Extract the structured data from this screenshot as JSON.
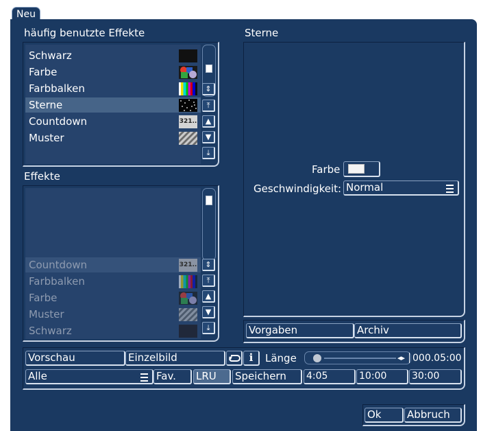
{
  "dialog": {
    "tab_label": "Neu"
  },
  "favorites": {
    "title": "häufig benutzte Effekte",
    "items": [
      {
        "label": "Schwarz",
        "thumb_icon": "black-swatch-thumbnail"
      },
      {
        "label": "Farbe",
        "thumb_icon": "color-shapes-thumbnail"
      },
      {
        "label": "Farbbalken",
        "thumb_icon": "color-bars-thumbnail"
      },
      {
        "label": "Sterne",
        "thumb_icon": "stars-thumbnail",
        "selected": true
      },
      {
        "label": "Countdown",
        "thumb_icon": "countdown-thumbnail",
        "thumb_text": "321.."
      },
      {
        "label": "Muster",
        "thumb_icon": "pattern-thumbnail"
      }
    ]
  },
  "effects": {
    "title": "Effekte",
    "items": [
      {
        "label": "Countdown",
        "thumb_icon": "countdown-thumbnail",
        "thumb_text": "321.."
      },
      {
        "label": "Farbbalken",
        "thumb_icon": "color-bars-thumbnail"
      },
      {
        "label": "Farbe",
        "thumb_icon": "color-shapes-thumbnail"
      },
      {
        "label": "Muster",
        "thumb_icon": "pattern-thumbnail"
      },
      {
        "label": "Schwarz",
        "thumb_icon": "black-swatch-thumbnail"
      }
    ]
  },
  "sterne": {
    "title": "Sterne",
    "farbe_label": "Farbe",
    "farbe_value": "#f4f4f4",
    "speed_label": "Geschwindigkeit:",
    "speed_value": "Normal",
    "vorgaben_label": "Vorgaben",
    "archiv_label": "Archiv"
  },
  "toolbar": {
    "vorschau_label": "Vorschau",
    "einzelbild_label": "Einzelbild",
    "info_label": "i",
    "laenge_label": "Länge",
    "laenge_value": "000.05:00",
    "filter_value": "Alle",
    "fav_label": "Fav.",
    "lru_label": "LRU",
    "speichern_label": "Speichern",
    "preset_1": "4:05",
    "preset_2": "10:00",
    "preset_3": "30:00"
  },
  "footer": {
    "ok_label": "Ok",
    "cancel_label": "Abbruch"
  },
  "colors": {
    "background": "#1a3961",
    "selection": "#466488",
    "panel": "#26436c"
  }
}
